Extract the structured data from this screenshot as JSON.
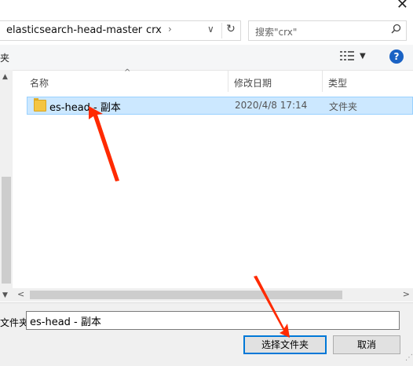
{
  "window": {
    "close_glyph": "✕"
  },
  "address_bar": {
    "crumbs": [
      "elasticsearch-head-master",
      "crx"
    ],
    "separator": "›",
    "dropdown_glyph": "∨",
    "refresh_glyph": "↻"
  },
  "search": {
    "placeholder": "搜索\"crx\"",
    "icon": "search-icon"
  },
  "toolbar": {
    "left_fragment": "夹"
  },
  "file_list": {
    "columns": {
      "name": "名称",
      "date": "修改日期",
      "type": "类型"
    },
    "rows": [
      {
        "name": "es-head - 副本",
        "date": "2020/4/8 17:14",
        "type": "文件夹"
      }
    ]
  },
  "bottom": {
    "folder_label": "文件夹:",
    "folder_value": "es-head - 副本",
    "ok_button": "选择文件夹",
    "cancel_button": "取消"
  },
  "colors": {
    "selection": "#cce8ff",
    "accent": "#0078d7",
    "annotation_arrow": "#ff2a00",
    "folder": "#f4c542"
  }
}
